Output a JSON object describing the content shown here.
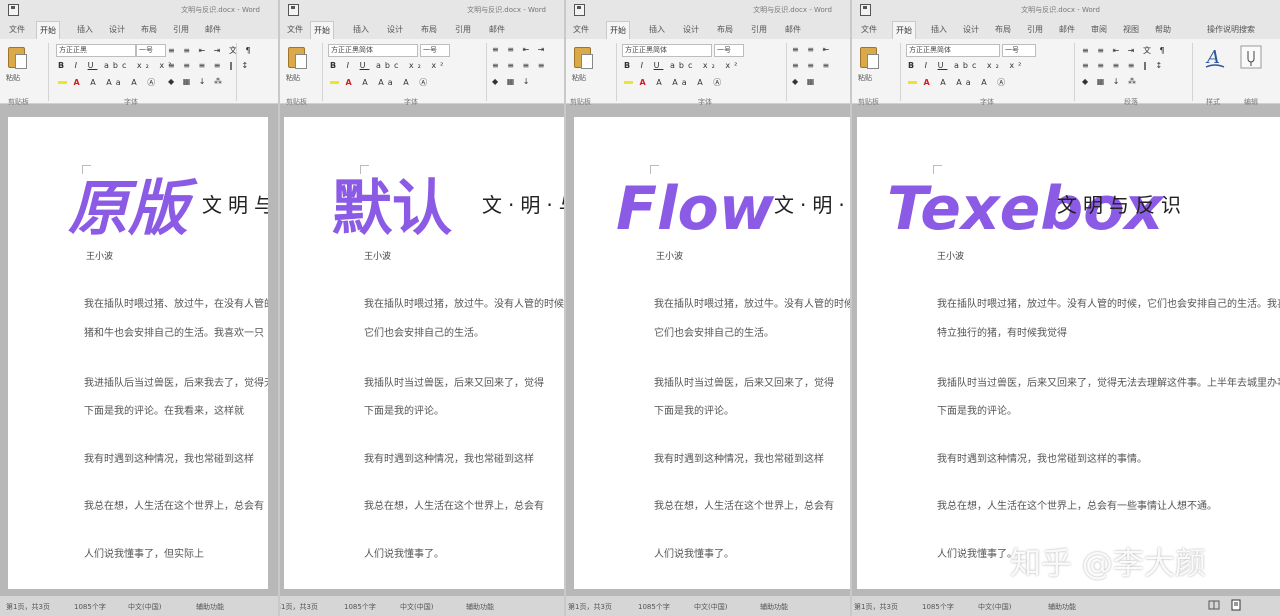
{
  "panels": [
    {
      "doc_title": "文明与反识.docx - Word",
      "tabs": [
        "文件",
        "开始",
        "插入",
        "设计",
        "布局",
        "引用",
        "邮件"
      ],
      "active_tab": "开始",
      "font_name": "方正正黑",
      "font_size": "一号",
      "groups": {
        "clipboard": "剪贴板",
        "font": "字体",
        "paste": "粘贴"
      },
      "big_title": "原版",
      "subtitle": "文明与",
      "author": "王小波",
      "lines": [
        "我在插队时喂过猪、放过牛，在没有人管的时候，",
        "猪和牛也会安排自己的生活。我喜欢一只",
        "我进插队后当过兽医，后来我去了，觉得无法",
        "下面是我的评论。在我看来，这样就",
        "我有时遇到这种情况，我也常碰到这样",
        "我总在想，人生活在这个世界上，总会有",
        "人们说我懂事了，但实际上"
      ],
      "status": {
        "page": "第1页，共3页",
        "words": "1085个字",
        "lang": "中文(中国)",
        "mode": "辅助功能"
      }
    },
    {
      "doc_title": "文明与反识.docx - Word",
      "tabs": [
        "文件",
        "开始",
        "插入",
        "设计",
        "布局",
        "引用",
        "邮件"
      ],
      "active_tab": "开始",
      "font_name": "方正正黑简体",
      "font_size": "一号",
      "groups": {
        "clipboard": "剪贴板",
        "font": "字体",
        "paste": "粘贴"
      },
      "big_title": "默认",
      "subtitle": "文·明·与·",
      "author": "王小波",
      "lines": [
        "我在插队时喂过猪，放过牛。没有人管的时候，",
        "它们也会安排自己的生活。",
        "我插队时当过兽医，后来又回来了，觉得",
        "下面是我的评论。",
        "我有时遇到这种情况，我也常碰到这样",
        "我总在想，人生活在这个世界上，总会有",
        "人们说我懂事了。"
      ],
      "status": {
        "page": "第1页，共3页",
        "words": "1085个字",
        "lang": "中文(中国)",
        "mode": "辅助功能"
      }
    },
    {
      "doc_title": "文明与反识.docx - Word",
      "tabs": [
        "文件",
        "开始",
        "插入",
        "设计",
        "布局",
        "引用",
        "邮件"
      ],
      "active_tab": "开始",
      "font_name": "方正正黑简体",
      "font_size": "一号",
      "groups": {
        "clipboard": "剪贴板",
        "font": "字体",
        "paste": "粘贴"
      },
      "big_title": "Flow",
      "subtitle": "文·明·与",
      "author": "王小波",
      "lines": [
        "我在插队时喂过猪，放过牛。没有人管的时候，",
        "它们也会安排自己的生活。",
        "我插队时当过兽医，后来又回来了，觉得",
        "下面是我的评论。",
        "我有时遇到这种情况，我也常碰到这样",
        "我总在想，人生活在这个世界上，总会有",
        "人们说我懂事了。"
      ],
      "status": {
        "page": "第1页，共3页",
        "words": "1085个字",
        "lang": "中文(中国)",
        "mode": "辅助功能"
      }
    },
    {
      "doc_title": "文明与反识.docx - Word",
      "tabs": [
        "文件",
        "开始",
        "插入",
        "设计",
        "布局",
        "引用",
        "邮件",
        "审阅",
        "视图",
        "帮助"
      ],
      "active_tab": "开始",
      "font_name": "方正正黑简体",
      "font_size": "一号",
      "groups": {
        "clipboard": "剪贴板",
        "font": "字体",
        "paragraph": "段落",
        "styles": "样式",
        "edit": "编辑",
        "paste": "粘贴",
        "tell_me": "操作说明搜索"
      },
      "big_title": "Texebox",
      "subtitle": "文明与反识",
      "author": "王小波",
      "lines": [
        "我在插队时喂过猪，放过牛。没有人管的时候，它们也会安排自己的生活。我喜欢一只",
        "特立独行的猪，有时候我觉得",
        "我插队时当过兽医，后来又回来了，觉得无法去理解这件事。上半年去城里办事，就",
        "下面是我的评论。",
        "我有时遇到这种情况，我也常碰到这样的事情。",
        "我总在想，人生活在这个世界上，总会有一些事情让人想不通。",
        "人们说我懂事了。"
      ],
      "status": {
        "page": "第1页，共3页",
        "words": "1085个字",
        "lang": "中文(中国)",
        "mode": "辅助功能"
      }
    }
  ],
  "watermark": "知乎 @李大颜",
  "colors": {
    "title_purple": "#8c5be6",
    "ribbon_bg": "#f4f4f4",
    "status_bg": "#d6d6d6"
  }
}
